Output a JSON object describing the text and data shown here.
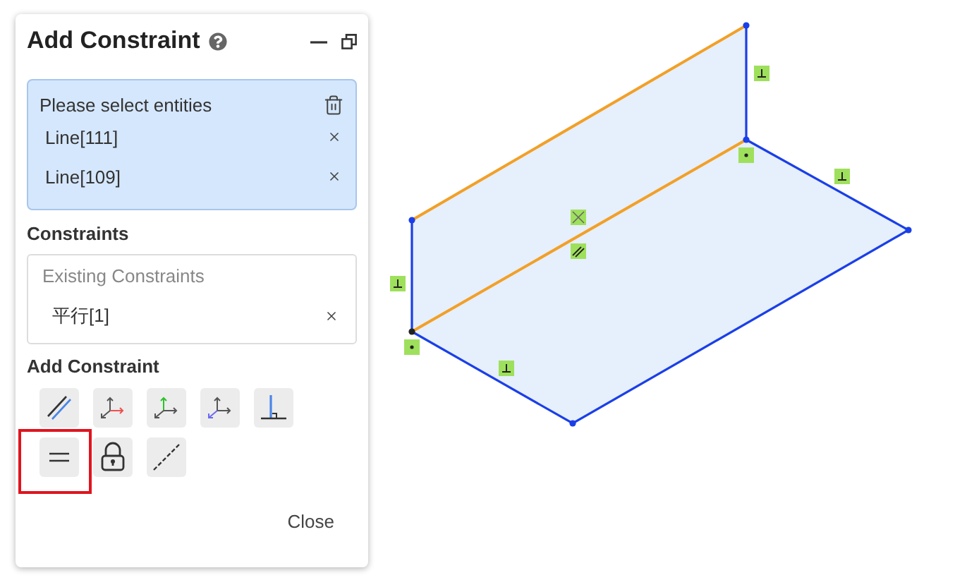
{
  "panel": {
    "title": "Add Constraint",
    "selection": {
      "prompt": "Please select entities",
      "items": [
        {
          "label": "Line[111]"
        },
        {
          "label": "Line[109]"
        }
      ]
    },
    "constraints": {
      "heading": "Constraints",
      "list_title": "Existing Constraints",
      "items": [
        {
          "label": "平行[1]"
        }
      ]
    },
    "add": {
      "heading": "Add Constraint",
      "tools": [
        {
          "kind": "parallel",
          "highlighted": false
        },
        {
          "kind": "axis-x",
          "highlighted": false
        },
        {
          "kind": "axis-y",
          "highlighted": false
        },
        {
          "kind": "axis-z",
          "highlighted": false
        },
        {
          "kind": "perpendicular",
          "highlighted": false
        },
        {
          "kind": "equal",
          "highlighted": true
        },
        {
          "kind": "fix",
          "highlighted": false
        },
        {
          "kind": "collinear",
          "highlighted": false
        }
      ]
    },
    "close_button": "Close"
  }
}
